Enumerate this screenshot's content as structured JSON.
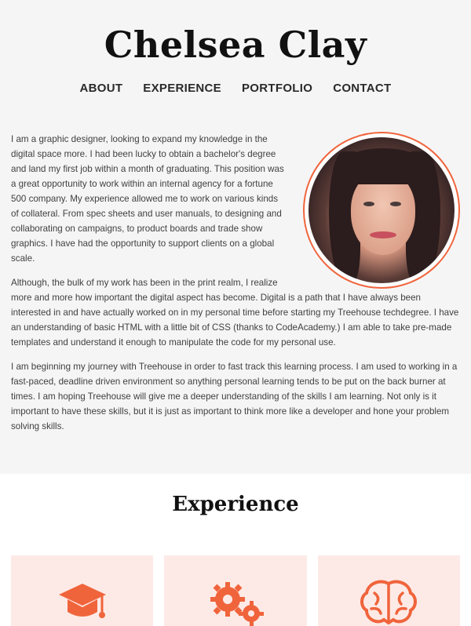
{
  "header": {
    "name": "Chelsea Clay"
  },
  "nav": {
    "items": [
      "ABOUT",
      "EXPERIENCE",
      "PORTFOLIO",
      "CONTACT"
    ]
  },
  "about": {
    "paragraphs": [
      "I am a graphic designer, looking to expand my knowledge in the digital space more. I had been lucky to obtain a bachelor's degree and land my first job within a month of graduating. This position was a great opportunity to work within an internal agency for a fortune 500 company. My experience allowed me to work on various kinds of collateral. From spec sheets and user manuals, to designing and collaborating on campaigns, to product boards and trade show graphics. I have had the opportunity to support clients on a global scale.",
      "Although, the bulk of my work has been in the print realm, I realize more and more how important the digital aspect has become. Digital is a path that I have always been interested in and have actually worked on in my personal time before starting my Treehouse techdegree. I have an understanding of basic HTML with a little bit of CSS (thanks to CodeAcademy.) I am able to take pre-made templates and understand it enough to manipulate the code for my personal use.",
      "I am beginning my journey with Treehouse in order to fast track this learning process. I am used to working in a fast-paced, deadline driven environment so anything personal learning tends to be put on the back burner at times. I am hoping Treehouse will give me a deeper understanding of the skills I am learning. Not only is it important to have these skills, but it is just as important to think more like a developer and hone your problem solving skills."
    ]
  },
  "experience": {
    "title": "Experience",
    "cards": [
      {
        "icon": "graduation-cap-icon"
      },
      {
        "icon": "gears-icon"
      },
      {
        "icon": "brain-icon"
      }
    ]
  },
  "colors": {
    "accent": "#f0643c",
    "hero_bg": "#f6f5f5",
    "card_bg": "#fdeae6"
  }
}
